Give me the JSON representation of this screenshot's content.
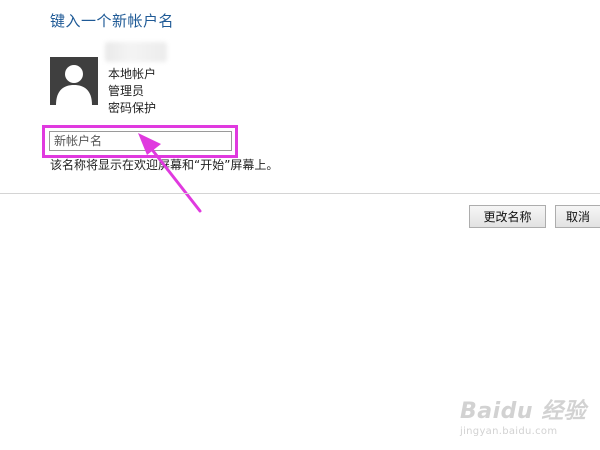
{
  "header": {
    "title": "键入一个新帐户名"
  },
  "account": {
    "type": "本地帐户",
    "role": "管理员",
    "security": "密码保护"
  },
  "form": {
    "name_placeholder": "新帐户名",
    "hint": "该名称将显示在欢迎屏幕和“开始”屏幕上。"
  },
  "buttons": {
    "rename_label": "更改名称",
    "cancel_label": "取消"
  },
  "annotation": {
    "color": "#e03adf"
  },
  "watermark": {
    "brand": "Baidu 经验",
    "site": "jingyan.baidu.com"
  }
}
